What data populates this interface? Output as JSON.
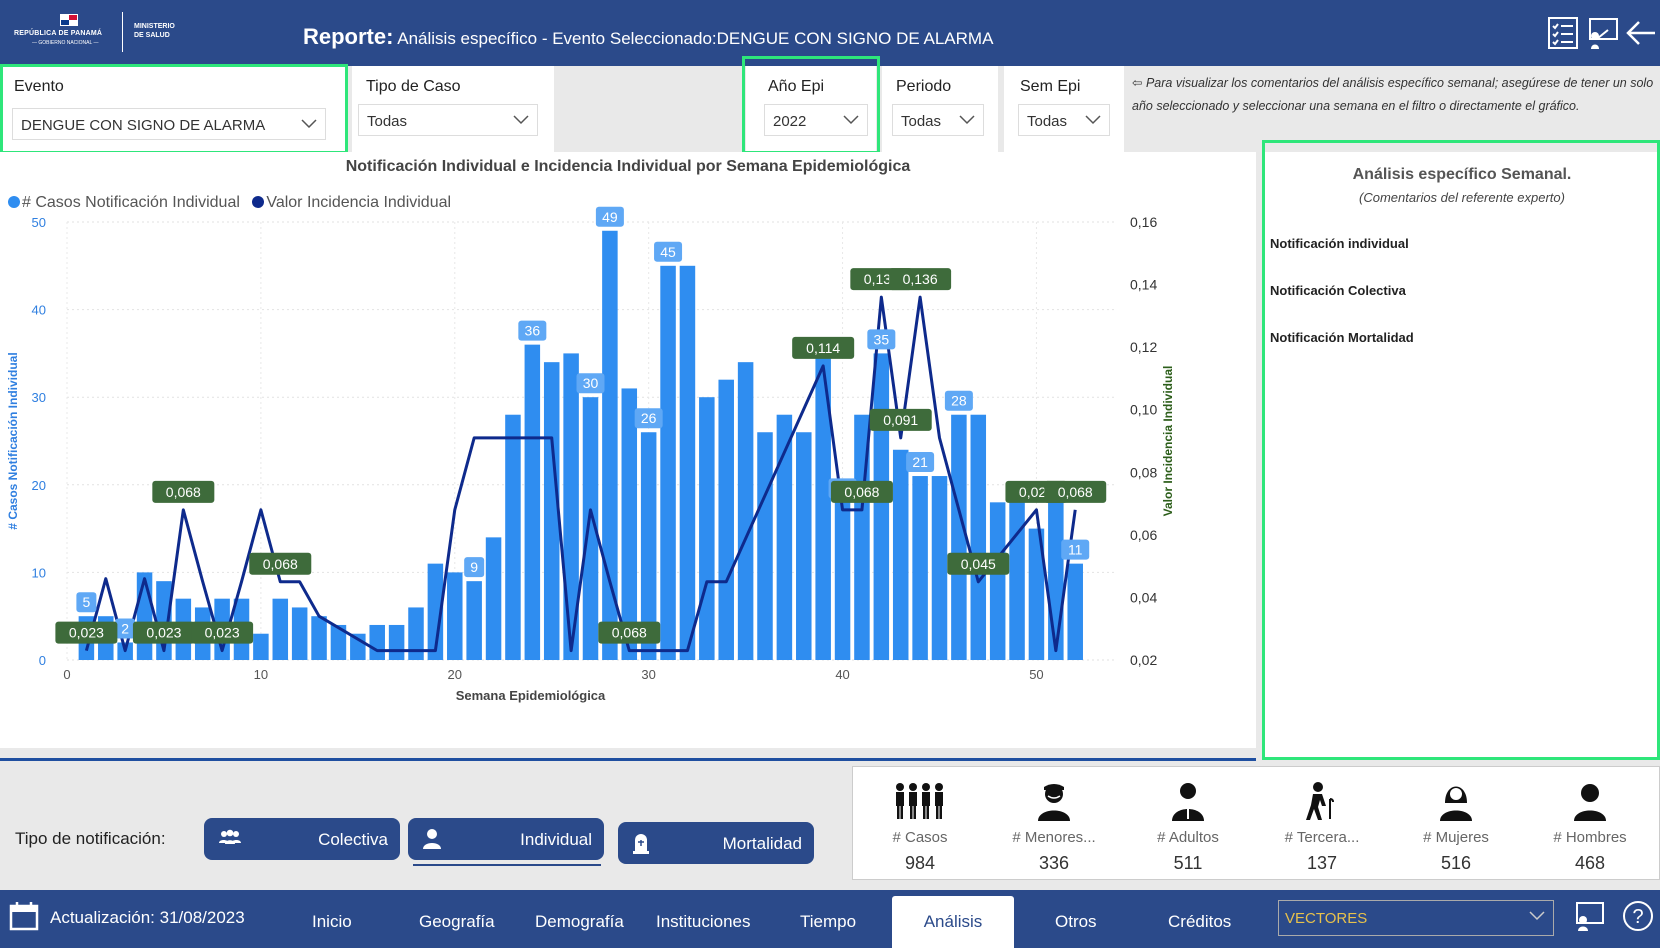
{
  "header": {
    "logo_line1": "REPÚBLICA DE PANAMÁ",
    "logo_line2": "— GOBIERNO NACIONAL —",
    "logo_line3a": "MINISTERIO",
    "logo_line3b": "DE SALUD",
    "title_prefix": "Reporte:",
    "title_text": "Análisis específico - Evento Seleccionado:DENGUE CON SIGNO DE ALARMA",
    "icons": [
      "checklist-icon",
      "presentation-icon",
      "back-arrow-icon"
    ]
  },
  "filters": {
    "evento": {
      "label": "Evento",
      "value": "DENGUE CON SIGNO DE ALARMA"
    },
    "tipo_caso": {
      "label": "Tipo de Caso",
      "value": "Todas"
    },
    "anio_epi": {
      "label": "Año Epi",
      "value": "2022"
    },
    "periodo": {
      "label": "Periodo",
      "value": "Todas"
    },
    "sem_epi": {
      "label": "Sem Epi",
      "value": "Todas"
    }
  },
  "note": "⇦ Para visualizar los comentarios del análisis específico semanal; asegúrese de tener un solo año seleccionado y seleccionar una semana en el filtro o directamente el gráfico.",
  "chart_data": {
    "type": "bar+line",
    "title": "Notificación Individual e Incidencia Individual por Semana Epidemiológica",
    "xlabel": "Semana Epidemiológica",
    "ylabel_left": "# Casos Notificación Individual",
    "ylabel_right": "Valor Incidencia Individual",
    "legend": [
      "# Casos Notificación Individual",
      "Valor Incidencia Individual"
    ],
    "xlim": [
      0,
      54
    ],
    "ylim_left": [
      0,
      50
    ],
    "ylim_right": [
      0.02,
      0.16
    ],
    "x_ticks": [
      0,
      10,
      20,
      30,
      40,
      50
    ],
    "y_ticks_left": [
      0,
      10,
      20,
      30,
      40,
      50
    ],
    "y_ticks_right": [
      "0,02",
      "0,04",
      "0,06",
      "0,08",
      "0,10",
      "0,12",
      "0,14",
      "0,16"
    ],
    "weeks": [
      1,
      2,
      3,
      4,
      5,
      6,
      7,
      8,
      9,
      10,
      11,
      12,
      13,
      14,
      15,
      16,
      17,
      18,
      19,
      20,
      21,
      22,
      23,
      24,
      25,
      26,
      27,
      28,
      29,
      30,
      31,
      32,
      33,
      34,
      35,
      36,
      37,
      38,
      39,
      40,
      41,
      42,
      43,
      44,
      45,
      46,
      47,
      48,
      49,
      50,
      51,
      52
    ],
    "cases": [
      5,
      5,
      2,
      10,
      9,
      7,
      6,
      7,
      7,
      3,
      7,
      6,
      5,
      4,
      3,
      4,
      4,
      6,
      11,
      10,
      9,
      14,
      28,
      36,
      34,
      35,
      30,
      49,
      31,
      26,
      45,
      45,
      30,
      32,
      34,
      26,
      28,
      26,
      35,
      18,
      28,
      35,
      24,
      21,
      21,
      28,
      28,
      18,
      18,
      15,
      18,
      11
    ],
    "incidence": [
      0.023,
      0.046,
      0.023,
      0.046,
      0.023,
      0.068,
      0.045,
      0.023,
      0.045,
      0.068,
      0.045,
      0.045,
      0.034,
      0.023,
      0.023,
      0.023,
      0.023,
      0.068,
      0.091,
      0.091,
      0.091,
      0.091,
      0.091,
      0.023,
      0.068,
      0.045,
      0.023,
      0.023,
      0.023,
      0.023,
      0.045,
      0.045,
      0.114,
      0.068,
      0.068,
      0.136,
      0.091,
      0.136,
      0.091,
      0.045,
      0.068,
      0.023,
      0.068
    ],
    "incidence_weeks": [
      1,
      2,
      3,
      4,
      5,
      6,
      7,
      8,
      9,
      10,
      11,
      12,
      13,
      16,
      17,
      18,
      19,
      20,
      21,
      22,
      23,
      24,
      25,
      26,
      27,
      28,
      29,
      30,
      31,
      32,
      33,
      34,
      39,
      40,
      41,
      42,
      43,
      44,
      45,
      47,
      50,
      51,
      52
    ],
    "bar_labels": [
      {
        "week": 1,
        "text": "5"
      },
      {
        "week": 3,
        "text": "2"
      },
      {
        "week": 21,
        "text": "9"
      },
      {
        "week": 24,
        "text": "36"
      },
      {
        "week": 27,
        "text": "30"
      },
      {
        "week": 28,
        "text": "49"
      },
      {
        "week": 30,
        "text": "26"
      },
      {
        "week": 31,
        "text": "45"
      },
      {
        "week": 40,
        "text": "18"
      },
      {
        "week": 42,
        "text": "35"
      },
      {
        "week": 44,
        "text": "21"
      },
      {
        "week": 46,
        "text": "28"
      },
      {
        "week": 52,
        "text": "11"
      }
    ],
    "line_labels": [
      {
        "week": 1,
        "text": "0,023"
      },
      {
        "week": 5,
        "text": "0,023"
      },
      {
        "week": 8,
        "text": "0,023"
      },
      {
        "week": 6,
        "text": "0,068"
      },
      {
        "week": 11,
        "text": "0,068"
      },
      {
        "week": 29,
        "text": "0,068"
      },
      {
        "week": 39,
        "text": "0,114"
      },
      {
        "week": 41,
        "text": "0,068"
      },
      {
        "week": 42,
        "text": "0,136"
      },
      {
        "week": 43,
        "text": "0,091"
      },
      {
        "week": 44,
        "text": "0,136"
      },
      {
        "week": 47,
        "text": "0,045"
      },
      {
        "week": 50,
        "text": "0,023"
      },
      {
        "week": 52,
        "text": "0,068"
      }
    ],
    "colors": {
      "bars": "#2f8df0",
      "bar_label_bg": "#5fa8f5",
      "line": "#0e2a8c",
      "line_label_bg": "#3e6b3b"
    }
  },
  "analysis": {
    "title": "Análisis específico Semanal.",
    "subtitle": "(Comentarios del referente experto)",
    "sections": [
      "Notificación individual",
      "Notificación Colectiva",
      "Notificación Mortalidad"
    ]
  },
  "tipo_notificacion": {
    "label": "Tipo de notificación:",
    "buttons": [
      {
        "label": "Colectiva",
        "icon": "group-icon"
      },
      {
        "label": "Individual",
        "icon": "person-icon"
      },
      {
        "label": "Mortalidad",
        "icon": "tombstone-icon"
      }
    ]
  },
  "kpis": [
    {
      "label": "# Casos",
      "value": "984",
      "icon": "people-group-icon"
    },
    {
      "label": "# Menores...",
      "value": "336",
      "icon": "child-icon"
    },
    {
      "label": "# Adultos",
      "value": "511",
      "icon": "adult-icon"
    },
    {
      "label": "# Tercera...",
      "value": "137",
      "icon": "elderly-icon"
    },
    {
      "label": "# Mujeres",
      "value": "516",
      "icon": "woman-icon"
    },
    {
      "label": "# Hombres",
      "value": "468",
      "icon": "man-icon"
    }
  ],
  "nav": {
    "update": "Actualización: 31/08/2023",
    "tabs": [
      "Inicio",
      "Geografía",
      "Demografía",
      "Instituciones",
      "Tiempo",
      "Análisis",
      "Otros",
      "Créditos"
    ],
    "active_tab": "Análisis",
    "dropdown_value": "VECTORES",
    "accent": "#e7c14c"
  }
}
